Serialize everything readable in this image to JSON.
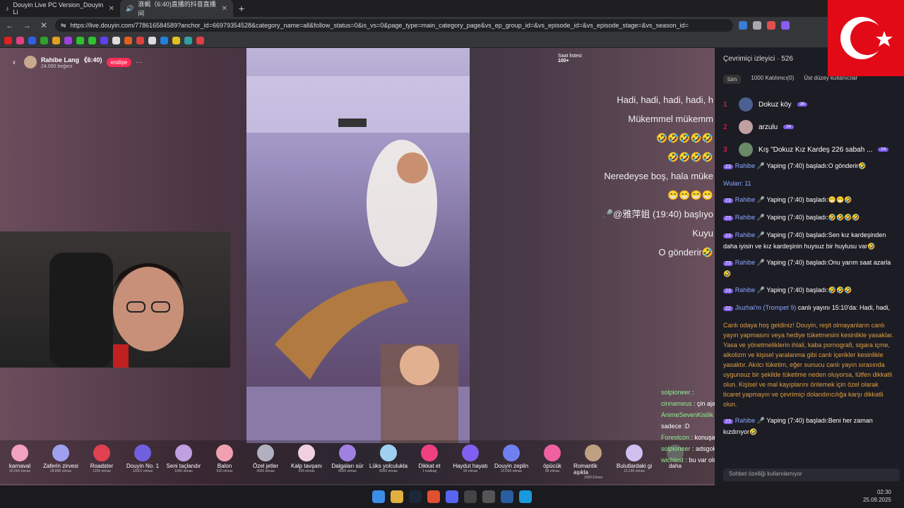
{
  "browser": {
    "tabs": [
      {
        "title": "Douyin Live PC Version_Douyin Li",
        "active": false
      },
      {
        "title": "浪蝎（6:40)直播的抖音直播间",
        "active": true
      }
    ],
    "url": "https://live.douyin.com/778616584589?anchor_id=66979354528&category_name=all&follow_status=0&is_vs=0&page_type=main_category_page&vs_ep_group_id=&vs_episode_id=&vs_episode_stage=&vs_season_id="
  },
  "stream": {
    "streamer_name": "Rahibe Lang 《6:40)",
    "likes": "24.000 beğeni",
    "follow_label": "endişe",
    "rank_label": "Saat listesi",
    "rank_value": "100+",
    "overlay_lines": [
      "Hadi, hadi, hadi, hadi, h",
      "Mükemmel mükemm",
      "🤣🤣🤣🤣🤣",
      "🤣🤣🤣🤣",
      "Neredeyse boş, hala müke",
      "😁😁😁😁",
      "🎤@雅萍姐 (19:40) başlıyo",
      "Kuyu",
      "O gönderir🤣"
    ]
  },
  "gifts": [
    {
      "name": "karnaval",
      "price": "30.000 elmas",
      "color": "#f4a0c0"
    },
    {
      "name": "Zaferin zirvesi",
      "price": "28.888 elmas",
      "color": "#a0a0f0"
    },
    {
      "name": "Roadster",
      "price": "1200 elmas",
      "color": "#e04050"
    },
    {
      "name": "Douyin No. 1",
      "price": "10001 elmas",
      "color": "#7060e0"
    },
    {
      "name": "Seni taçlandır",
      "price": "1000 elmas",
      "color": "#c0a0e0"
    },
    {
      "name": "Balon",
      "price": "520 elmas",
      "color": "#f0a0b0"
    },
    {
      "name": "Özel jetler",
      "price": "3000 elmas",
      "color": "#b0b0c0"
    },
    {
      "name": "Kalp tavşanı",
      "price": "299 elmas",
      "color": "#f0d0e0"
    },
    {
      "name": "Dalgaları sür",
      "price": "8000 elmas",
      "color": "#a080e0"
    },
    {
      "name": "Lüks yolculukla",
      "price": "6000 elmas",
      "color": "#a0d0f0"
    },
    {
      "name": "Dikkat et",
      "price": "1 matkap",
      "color": "#f04080"
    },
    {
      "name": "Haydut hayatı",
      "price": "99 elmas",
      "color": "#8060f0"
    },
    {
      "name": "Douyin zeplin",
      "price": "20.000 elmas",
      "color": "#7080f0"
    },
    {
      "name": "öpücük",
      "price": "99 elmas",
      "color": "#f060a0"
    },
    {
      "name": "Romantik aşıkla",
      "price": "1999 Elmas",
      "color": "#c0a080"
    },
    {
      "name": "Bulutlardaki gi",
      "price": "13.140 elmas",
      "color": "#d0c0f0"
    },
    {
      "name": "daha",
      "price": "",
      "color": "#666"
    }
  ],
  "bottom_chat": [
    {
      "user": "solpioneer",
      "text": ":"
    },
    {
      "user": "cinnameus",
      "text": ": çin ajanı olduğu kanıtlandı"
    },
    {
      "user": "AnimeSevenKisilik",
      "text": ": yo bir an unutup gerçek kimliğinde konustun sandik"
    },
    {
      "user": "",
      "text": "sadece :D"
    },
    {
      "user": "Forestcon",
      "text": ": konuşabilmene şaşırmadık ki şu gözleri bi aç"
    },
    {
      "user": "solpioneer",
      "text": ": adsgokvplsdabinslşf mnlgdndg"
    },
    {
      "user": "wichlost",
      "text": ": bu var olmaz mı"
    }
  ],
  "panel": {
    "title": "Çevrimiçi izleyici · 526",
    "filters": [
      "tüm",
      "1000 Katılımcı(0)",
      "Üst düzey kullanıcılar"
    ],
    "ranks": [
      {
        "n": "1",
        "name": "Dokuz köy",
        "badge": "36",
        "color": "#4a6090"
      },
      {
        "n": "2",
        "name": "arzulu",
        "badge": "34",
        "color": "#c0a0a0"
      },
      {
        "n": "3",
        "name": "Kış \"Dokuz Kız Kardeş 226 sabah ...",
        "badge": "24",
        "color": "#6a8a6a"
      }
    ],
    "chat": [
      {
        "lvl": "23",
        "name": "Rahibe",
        "text": "🎤 Yaping (7:40) başladı:O gönderir🤣"
      },
      {
        "lvl": "",
        "name": "Wulan: 11",
        "text": ""
      },
      {
        "lvl": "23",
        "name": "Rahibe",
        "text": "🎤 Yaping (7:40) başladı:😁😁🤣"
      },
      {
        "lvl": "23",
        "name": "Rahibe",
        "text": "🎤 Yaping (7:40) başladı:🤣🤣🤣🤣"
      },
      {
        "lvl": "23",
        "name": "Rahibe",
        "text": "🎤 Yaping (7:40) başladı:Sen kız kardeşinden daha iyisin ve kız kardeşinin huysuz bir huylusu var🤣"
      },
      {
        "lvl": "23",
        "name": "Rahibe",
        "text": "🎤 Yaping (7:40) başladı:Onu yarım saat azarla🤣"
      },
      {
        "lvl": "23",
        "name": "Rahibe",
        "text": "🎤 Yaping (7:40) başladı:🤣🤣🤣"
      },
      {
        "lvl": "22",
        "name": "Jiuzhai'm (Trompet 9)",
        "text": "canlı yayını 15:10'da: Hadi, hadi,"
      }
    ],
    "system": "Canlı odaya hoş geldiniz! Douyin, reşit olmayanların canlı yayın yapmasını veya hediye tüketmesini kesinlikle yasaklar. Yasa ve yönetmeliklerin ihlali, kaba pornografi, sigara içme, alkolizm ve kişisel yaralanma gibi canlı içerikler kesinlikle yasaktır. Akılcı tüketim, eğer sunucu canlı yayın sırasında uygunsuz bir şekilde tüketime neden oluyorsa, lütfen dikkatli olun. Kişisel ve mal kayıplarını önlemek için özel olarak ticaret yapmayın ve çevrimiçi dolandırıcılığa karşı dikkatli olun.",
    "last": {
      "lvl": "23",
      "name": "Rahibe",
      "text": "🎤 Yaping (7:40) başladı:Beni her zaman kızdırıyor🤣"
    },
    "input_placeholder": "Sohbet özelliği kullanılamıyor"
  },
  "taskbar": {
    "time": "02:30",
    "date": "25.09.2025"
  }
}
